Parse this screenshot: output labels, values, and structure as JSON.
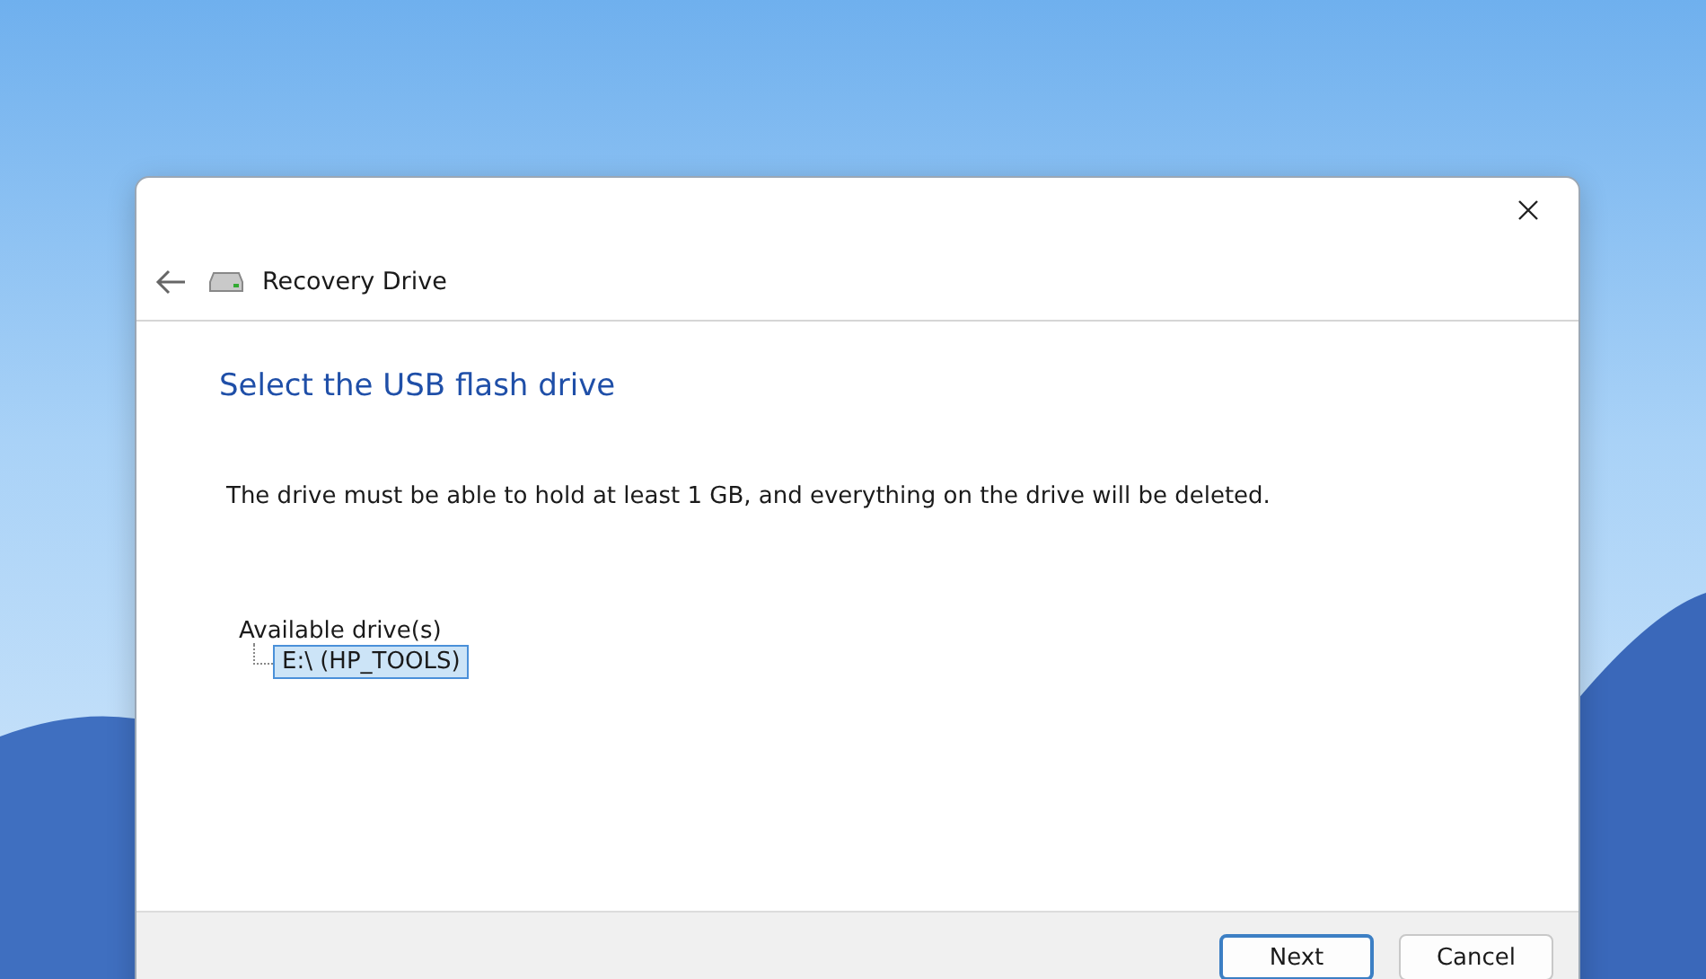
{
  "window": {
    "title": "Recovery Drive"
  },
  "heading": "Select the USB flash drive",
  "description": "The drive must be able to hold at least 1 GB, and everything on the drive will be deleted.",
  "drives": {
    "label": "Available drive(s)",
    "items": [
      {
        "label": "E:\\ (HP_TOOLS)",
        "selected": true
      }
    ]
  },
  "buttons": [
    {
      "label": "Next",
      "kind": "default"
    },
    {
      "label": "Cancel",
      "kind": "normal"
    }
  ]
}
